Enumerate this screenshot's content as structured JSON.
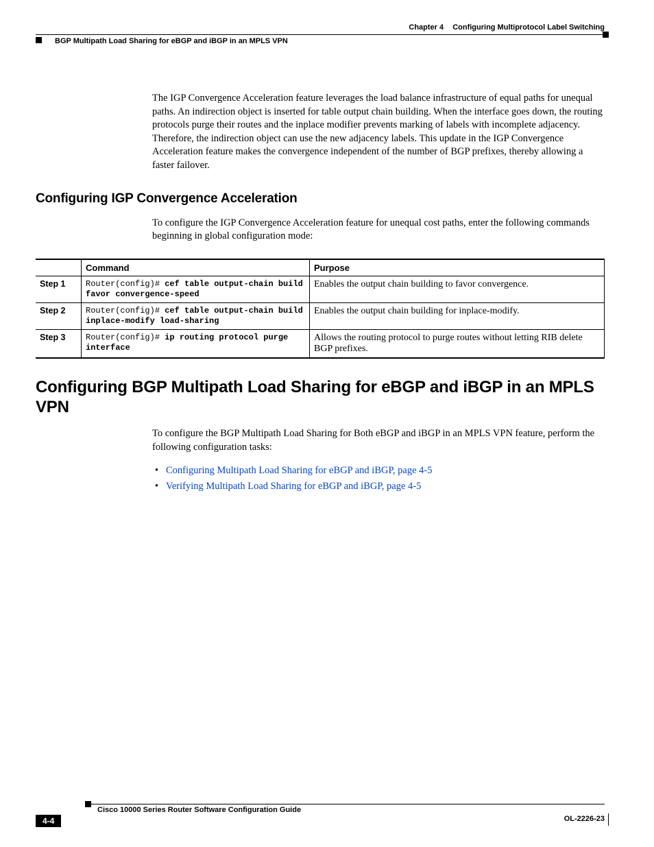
{
  "header": {
    "chapter_label": "Chapter 4",
    "chapter_title": "Configuring Multiprotocol Label Switching",
    "section_title": "BGP Multipath Load Sharing for eBGP and iBGP in an MPLS VPN"
  },
  "intro_paragraph": "The IGP Convergence Acceleration feature leverages the load balance infrastructure of equal paths for unequal paths. An indirection object is inserted for table output chain building. When the interface goes down, the routing protocols purge their routes and the inplace modifier prevents marking of labels with incomplete adjacency. Therefore, the indirection object can use the new adjacency labels. This update in the IGP Convergence Acceleration feature makes the convergence independent of the number of BGP prefixes, thereby allowing a faster failover.",
  "section1": {
    "heading": "Configuring IGP Convergence Acceleration",
    "lead": "To configure the IGP Convergence Acceleration feature for unequal cost paths, enter the following commands beginning in global configuration mode:",
    "table": {
      "head_command": "Command",
      "head_purpose": "Purpose",
      "rows": [
        {
          "step": "Step 1",
          "prompt": "Router(config)# ",
          "command": "cef table output-chain build favor convergence-speed",
          "purpose": "Enables the output chain building to favor convergence."
        },
        {
          "step": "Step 2",
          "prompt": "Router(config)# ",
          "command": "cef table output-chain build inplace-modify load-sharing",
          "purpose": "Enables the output chain building for inplace-modify."
        },
        {
          "step": "Step 3",
          "prompt": "Router(config)# ",
          "command": "ip routing protocol purge interface",
          "purpose": "Allows the routing protocol to purge routes without letting RIB delete BGP prefixes."
        }
      ]
    }
  },
  "section2": {
    "heading": "Configuring BGP Multipath Load Sharing for eBGP and iBGP in an MPLS VPN",
    "lead": "To configure the BGP Multipath Load Sharing for Both eBGP and iBGP in an MPLS VPN feature, perform the following configuration tasks:",
    "bullets": [
      "Configuring Multipath Load Sharing for eBGP and iBGP, page 4-5",
      "Verifying Multipath Load Sharing for eBGP and iBGP, page 4-5"
    ]
  },
  "footer": {
    "book_title": "Cisco 10000 Series Router Software Configuration Guide",
    "page_number": "4-4",
    "doc_id": "OL-2226-23"
  }
}
